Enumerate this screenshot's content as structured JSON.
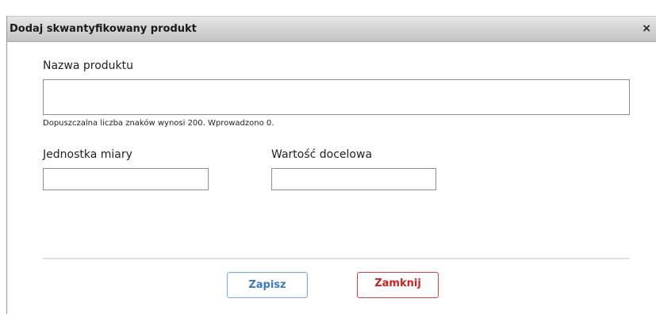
{
  "dialog": {
    "title": "Dodaj skwantyfikowany produkt",
    "close_glyph": "×"
  },
  "form": {
    "product_name_label": "Nazwa produktu",
    "product_name_value": "",
    "char_limit_hint": "Dopuszczalna liczba znaków wynosi 200. Wprowadzono 0.",
    "unit_label": "Jednostka miary",
    "unit_value": "",
    "target_value_label": "Wartość docelowa",
    "target_value_value": ""
  },
  "buttons": {
    "save_label": "Zapisz",
    "close_label": "Zamknij"
  },
  "colors": {
    "save_accent": "#3e78c8",
    "close_accent": "#d62020"
  }
}
